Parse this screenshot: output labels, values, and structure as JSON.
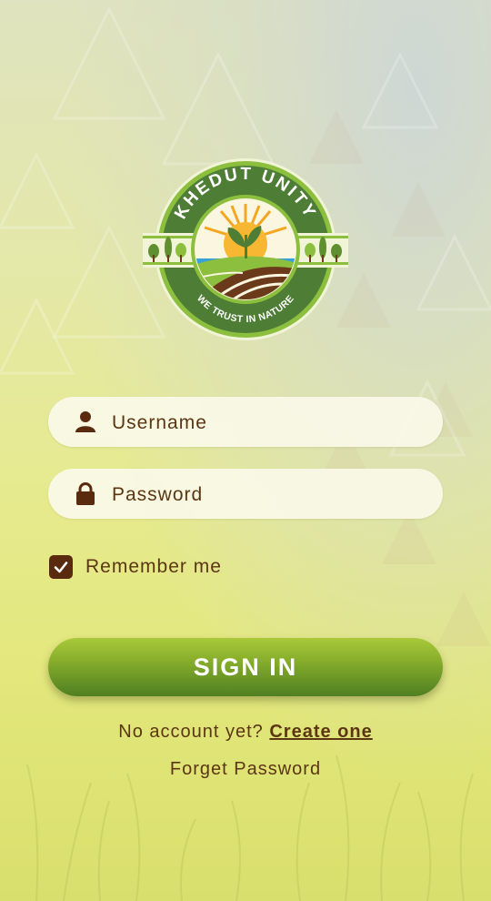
{
  "logo": {
    "brand": "KHEDUT UNITY",
    "tagline": "WE TRUST IN NATURE",
    "icon": "farm-badge-logo",
    "colors": {
      "ring": "#4e7d35",
      "accent": "#8dbf3f",
      "sun": "#f4a622",
      "soil": "#6b3a1b"
    }
  },
  "form": {
    "username_placeholder": "Username",
    "username_value": "",
    "username_icon": "user-icon",
    "password_placeholder": "Password",
    "password_value": "",
    "password_icon": "lock-icon",
    "remember_label": "Remember me",
    "remember_checked": true,
    "signin_label": "SIGN IN"
  },
  "footer": {
    "no_account_text": "No account yet?",
    "create_link": "Create one",
    "forgot_link": "Forget Password"
  },
  "colors": {
    "text_brown": "#5b3613",
    "button_green_top": "#a9c93a",
    "button_green_bottom": "#4f7f22",
    "checkbox_brown": "#5a2a0f"
  }
}
